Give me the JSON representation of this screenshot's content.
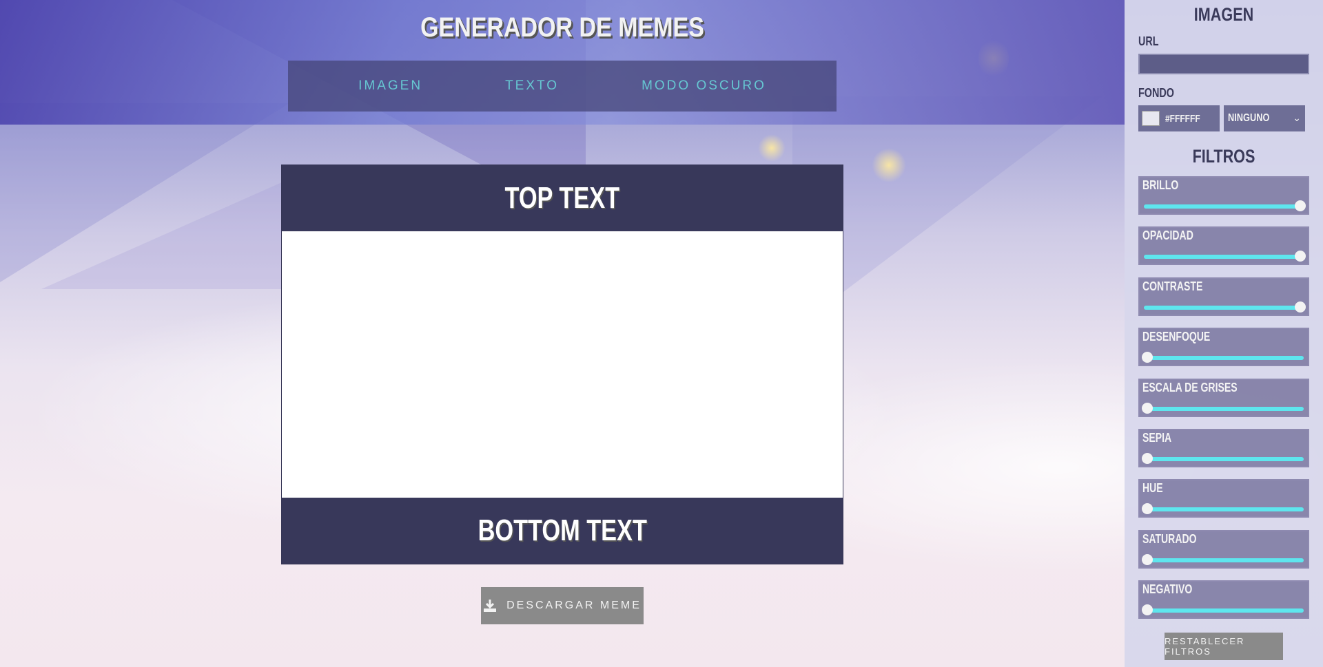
{
  "app": {
    "title": "GENERADOR DE MEMES"
  },
  "nav": [
    {
      "label": "IMAGEN"
    },
    {
      "label": "TEXTO"
    },
    {
      "label": "MODO OSCURO"
    }
  ],
  "meme": {
    "top_text": "TOP TEXT",
    "bottom_text": "BOTTOM TEXT",
    "image_background": "#ffffff"
  },
  "download": {
    "label": "DESCARGAR MEME",
    "icon": "download-icon"
  },
  "panel": {
    "image_heading": "IMAGEN",
    "url_label": "URL",
    "url_value": "",
    "fondo_label": "FONDO",
    "color_value": "#FFFFFF",
    "blend_value": "NINGUNO",
    "filters_heading": "FILTROS",
    "filters": [
      {
        "name": "BRILLO",
        "level": 1.0
      },
      {
        "name": "OPACIDAD",
        "level": 1.0
      },
      {
        "name": "CONTRASTE",
        "level": 1.0
      },
      {
        "name": "DESENFOQUE",
        "level": 0.0
      },
      {
        "name": "ESCALA DE GRISES",
        "level": 0.01
      },
      {
        "name": "SEPIA",
        "level": 0.0
      },
      {
        "name": "HUE",
        "level": 0.0
      },
      {
        "name": "SATURADO",
        "level": 0.0
      },
      {
        "name": "NEGATIVO",
        "level": 0.0
      }
    ],
    "reset_label": "RESTABLECER FILTROS"
  },
  "colors": {
    "accent": "#5ee6ee",
    "meme_band": "#38385a",
    "nav_text": "#66c7d2"
  }
}
